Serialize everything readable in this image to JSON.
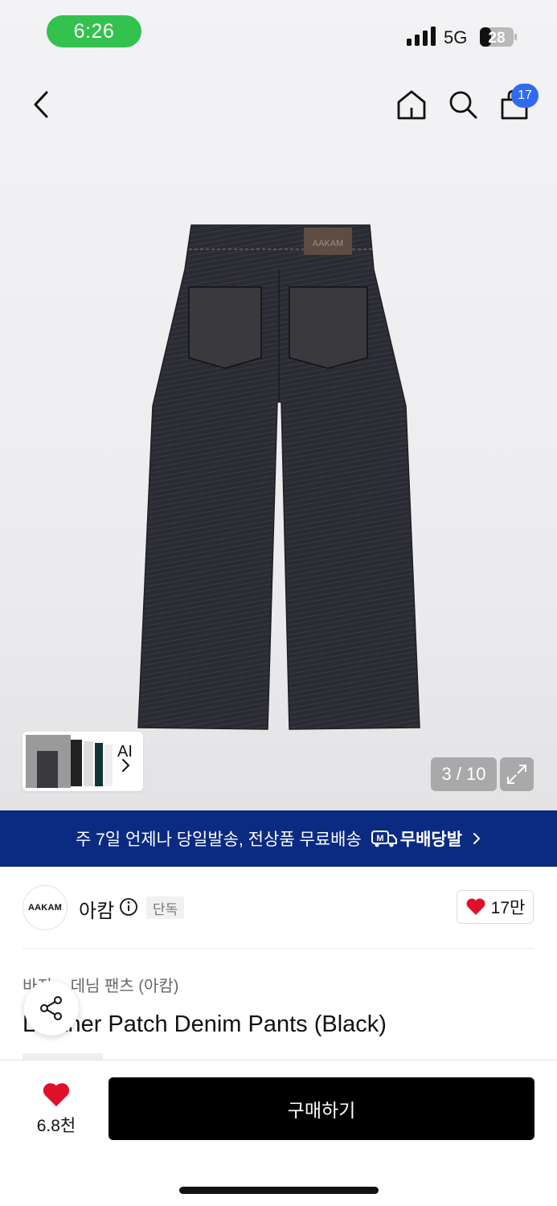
{
  "status_bar": {
    "time": "6:26",
    "network": "5G",
    "battery": "28"
  },
  "nav": {
    "cart_count": "17"
  },
  "gallery": {
    "thumbnail_label": "AI",
    "counter": "3 / 10"
  },
  "banner": {
    "text": "주 7일 언제나 당일발송, 전상품 무료배송",
    "brand_label": "무배당발"
  },
  "brand": {
    "logo_text": "AAKAM",
    "name": "아캄",
    "tag": "단독",
    "likes": "17만"
  },
  "product": {
    "breadcrumb": "바지 > 데님 팬츠 (아캄)",
    "title": "Leather Patch Denim Pants (Black)"
  },
  "bottom": {
    "favorite_count": "6.8천",
    "buy_label": "구매하기"
  },
  "colors": {
    "accent": "#2f6bf2",
    "banner": "#0b2b82",
    "heart": "#e0102a",
    "status": "#33c24d"
  }
}
